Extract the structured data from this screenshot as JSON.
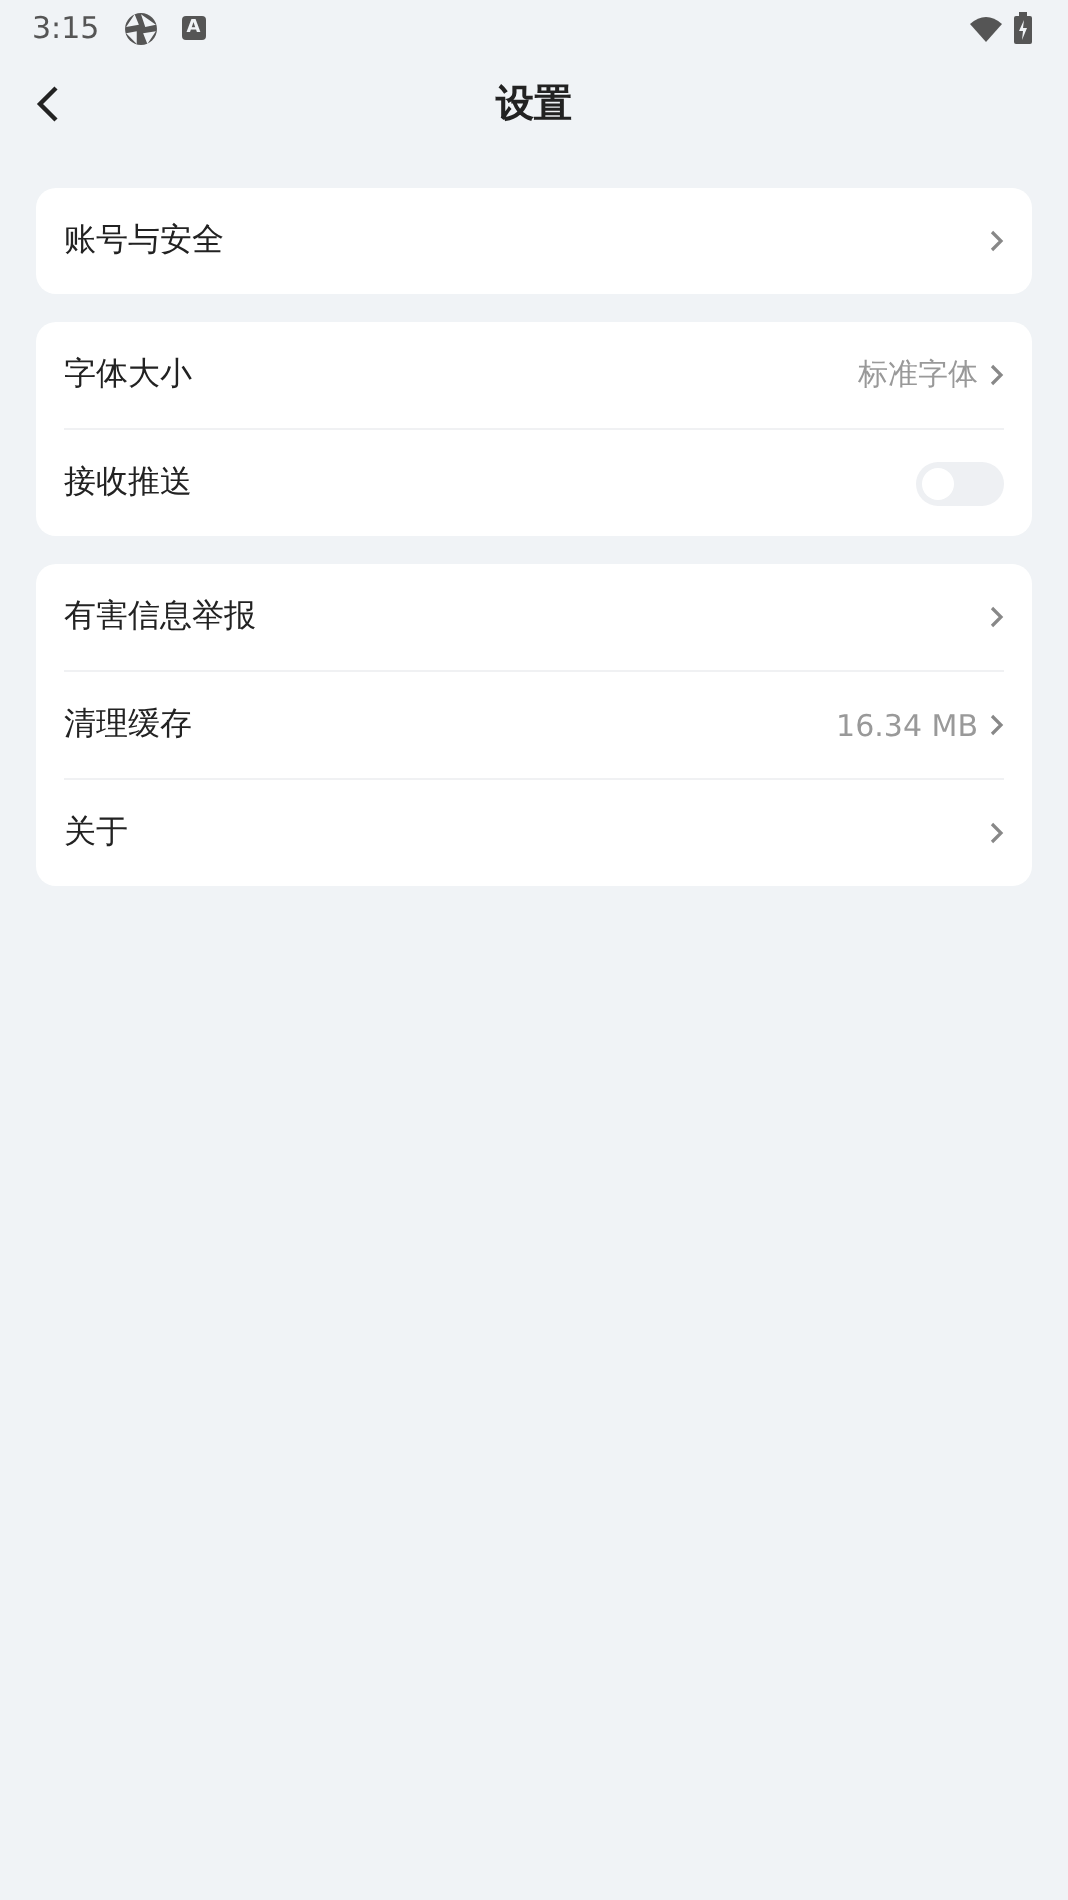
{
  "status_bar": {
    "time": "3:15",
    "keyboard_badge": "A"
  },
  "header": {
    "title": "设置"
  },
  "groups": [
    {
      "items": [
        {
          "kind": "link",
          "label": "账号与安全"
        }
      ]
    },
    {
      "items": [
        {
          "kind": "link",
          "label": "字体大小",
          "value": "标准字体"
        },
        {
          "kind": "toggle",
          "label": "接收推送",
          "on": false
        }
      ]
    },
    {
      "items": [
        {
          "kind": "link",
          "label": "有害信息举报"
        },
        {
          "kind": "link",
          "label": "清理缓存",
          "value": "16.34 MB"
        },
        {
          "kind": "link",
          "label": "关于"
        }
      ]
    }
  ]
}
